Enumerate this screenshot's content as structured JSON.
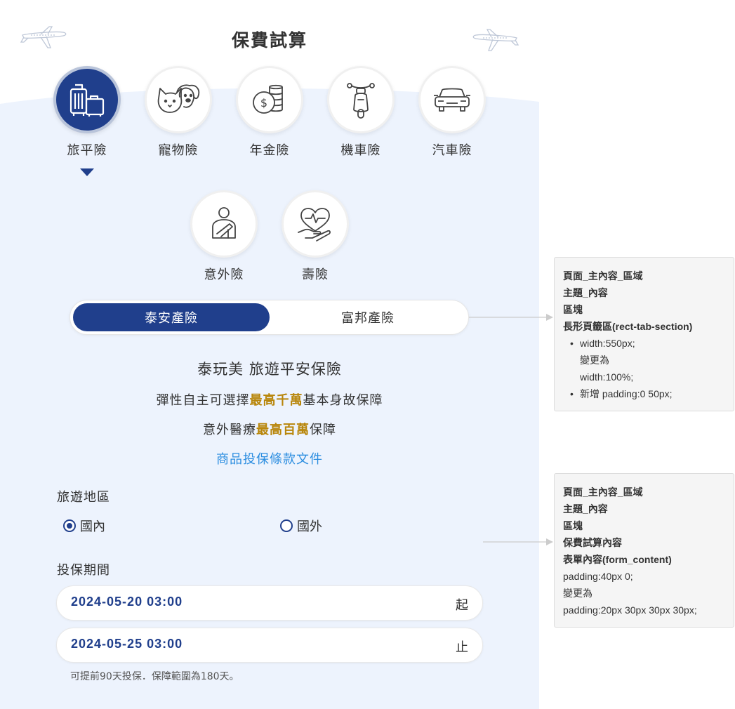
{
  "page": {
    "title": "保費試算"
  },
  "categories": [
    {
      "label": "旅平險",
      "icon": "luggage-icon",
      "active": true
    },
    {
      "label": "寵物險",
      "icon": "pet-icon",
      "active": false
    },
    {
      "label": "年金險",
      "icon": "coins-icon",
      "active": false
    },
    {
      "label": "機車險",
      "icon": "scooter-icon",
      "active": false
    },
    {
      "label": "汽車險",
      "icon": "car-icon",
      "active": false
    },
    {
      "label": "意外險",
      "icon": "injured-person-icon",
      "active": false
    },
    {
      "label": "壽險",
      "icon": "heart-hand-icon",
      "active": false
    }
  ],
  "tabs": {
    "items": [
      {
        "label": "泰安產險",
        "selected": true
      },
      {
        "label": "富邦產險",
        "selected": false
      }
    ]
  },
  "product": {
    "name": "泰玩美 旅遊平安保險",
    "feature1_prefix": "彈性自主可選擇",
    "feature1_highlight": "最高千萬",
    "feature1_suffix": "基本身故保障",
    "feature2_prefix": "意外醫療",
    "feature2_highlight": "最高百萬",
    "feature2_suffix": "保障",
    "doc_link": "商品投保條款文件"
  },
  "form": {
    "region_label": "旅遊地區",
    "region_options": [
      {
        "label": "國內",
        "checked": true
      },
      {
        "label": "國外",
        "checked": false
      }
    ],
    "period_label": "投保期間",
    "start_date": "2024-05-20 03:00",
    "start_suffix": "起",
    "end_date": "2024-05-25 03:00",
    "end_suffix": "止",
    "note": "可提前90天投保．保障範圍為180天。"
  },
  "annotations": [
    {
      "path": [
        "頁面_主內容_區域",
        "主題_內容",
        "區塊"
      ],
      "title": "長形頁籤區(rect-tab-section)",
      "bullets": [
        {
          "line1": "width:550px;",
          "line2": "變更為",
          "line3": "width:100%;"
        },
        {
          "line1": "新增 padding:0 50px;"
        }
      ]
    },
    {
      "path": [
        "頁面_主內容_區域",
        "主題_內容",
        "區塊",
        "保費試算內容"
      ],
      "title": "表單內容(form_content)",
      "lines": [
        "padding:40px 0;",
        "變更為",
        "padding:20px 30px 30px 30px;"
      ]
    }
  ],
  "colors": {
    "brand_navy": "#203f8c",
    "highlight_gold": "#b8860b",
    "link_blue": "#2b8de0",
    "panel_bg": "#edf3fd"
  }
}
